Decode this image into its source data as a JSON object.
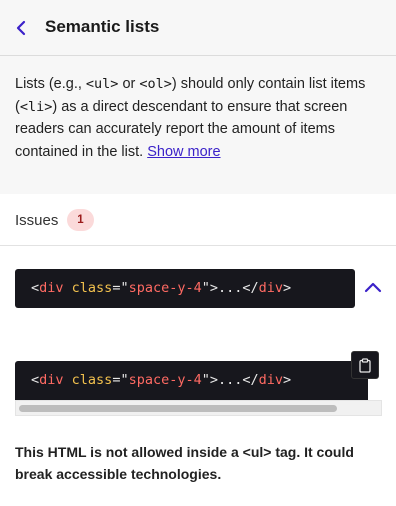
{
  "header": {
    "title": "Semantic lists"
  },
  "description": {
    "t1": "Lists (e.g., ",
    "c1": "<ul>",
    "t2": " or ",
    "c2": "<ol>",
    "t3": ") should only contain list items (",
    "c3": "<li>",
    "t4": ") as a direct descendant to ensure that screen readers can accurately report the amount of items contained in the list. ",
    "show_more": "Show more"
  },
  "issues": {
    "label": "Issues",
    "count": "1",
    "snippet": {
      "open_bracket": "<",
      "tag": "div",
      "space": " ",
      "attr": "class",
      "equals": "=\"",
      "value": "space-y-4",
      "close_quote": "\">",
      "ellipsis": "...",
      "close_open": "</",
      "close_tag": "div",
      "close_end": ">"
    },
    "message": "This HTML is not allowed inside a <ul> tag. It could break accessible technologies."
  },
  "colors": {
    "accent": "#3b22c9",
    "badge_bg": "#fbdada",
    "badge_text": "#9b1c1c",
    "code_bg": "#17171d",
    "code_tag": "#ff6a63",
    "code_attr": "#f2c14e"
  },
  "icons": {
    "back": "chevron-left-icon",
    "collapse": "chevron-up-icon",
    "copy": "clipboard-icon"
  }
}
